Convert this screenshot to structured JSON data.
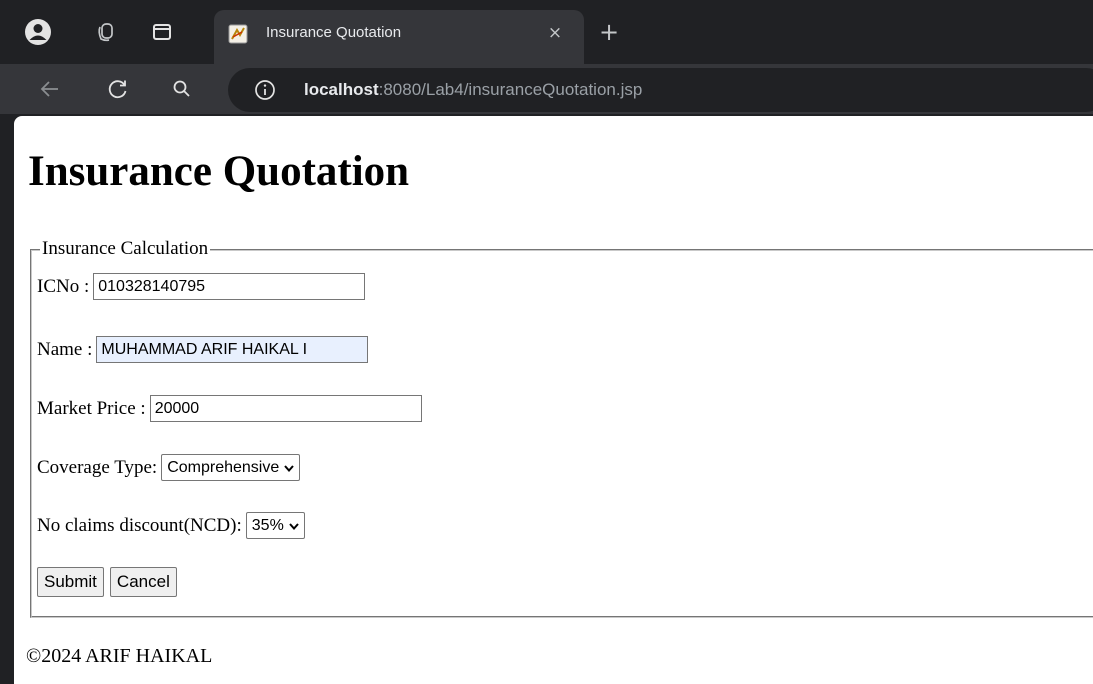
{
  "browser": {
    "tab_title": "Insurance Quotation",
    "tab_close": "×",
    "new_tab": "+",
    "url_host": "localhost",
    "url_rest": ":8080/Lab4/insuranceQuotation.jsp",
    "icons": [
      "profile-icon",
      "tab-groups-icon",
      "tab-search-icon",
      "favicon-icon",
      "back-arrow-icon",
      "reload-icon",
      "search-icon",
      "info-icon"
    ]
  },
  "page": {
    "heading": "Insurance Quotation",
    "legend": "Insurance Calculation",
    "icno": {
      "label": "ICNo :",
      "value": "010328140795"
    },
    "name": {
      "label": "Name :",
      "value": "MUHAMMAD ARIF HAIKAL I"
    },
    "market_price": {
      "label": "Market Price :",
      "value": "20000"
    },
    "coverage": {
      "label": "Coverage Type:",
      "selected": "Comprehensive"
    },
    "ncd": {
      "label": "No claims discount(NCD):",
      "selected": "35%"
    },
    "submit_label": "Submit",
    "cancel_label": "Cancel",
    "footer": "©2024 ARIF HAIKAL"
  },
  "colors": {
    "chrome_dark": "#202124",
    "chrome_toolbar": "#35363a",
    "autofill_bg": "#e8f0fe"
  }
}
